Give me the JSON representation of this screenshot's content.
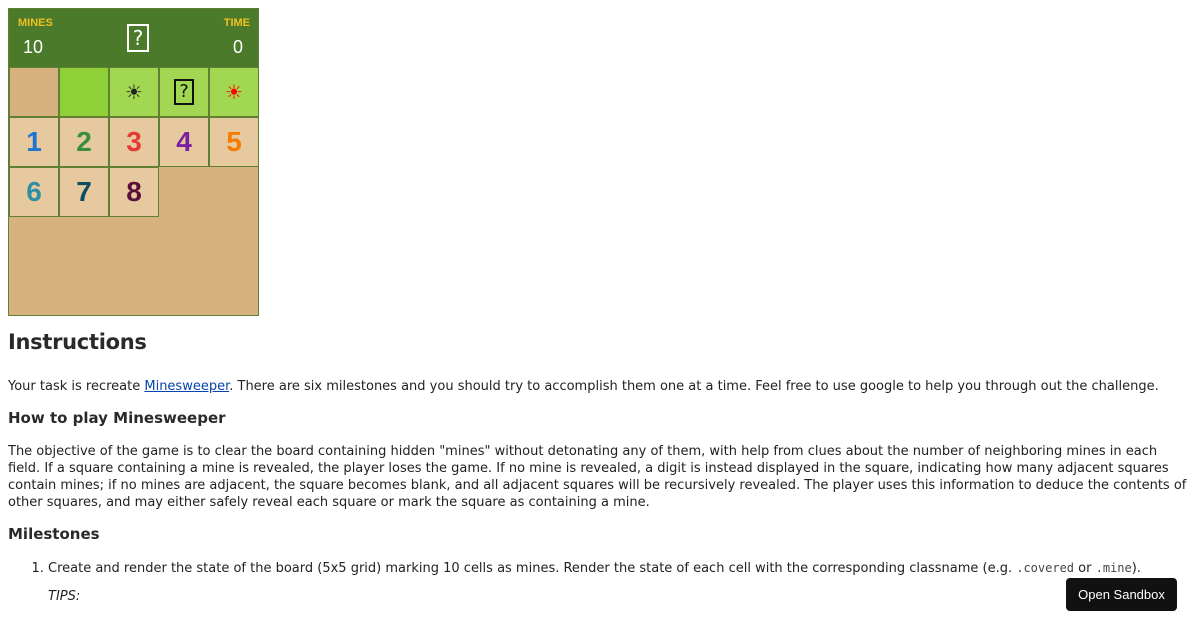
{
  "board": {
    "mines_label": "MINES",
    "mines_value": "10",
    "time_label": "TIME",
    "time_value": "0",
    "face_glyph": "?",
    "row1": [
      {
        "type": "blank",
        "text": ""
      },
      {
        "type": "covered",
        "text": ""
      },
      {
        "type": "mine",
        "text": "☀",
        "color": "#111111"
      },
      {
        "type": "unknown",
        "text": "?"
      },
      {
        "type": "mine-exploded",
        "text": "☀",
        "color": "#ff0000"
      }
    ],
    "numbers": [
      {
        "text": "1",
        "color": "#1e74d1"
      },
      {
        "text": "2",
        "color": "#388e3c"
      },
      {
        "text": "3",
        "color": "#e53935"
      },
      {
        "text": "4",
        "color": "#7b1fa2"
      },
      {
        "text": "5",
        "color": "#f57c00"
      },
      {
        "text": "6",
        "color": "#2e8fa0"
      },
      {
        "text": "7",
        "color": "#0b4c5f"
      },
      {
        "text": "8",
        "color": "#5a0f3a"
      }
    ]
  },
  "content": {
    "title": "Instructions",
    "intro_before": "Your task is recreate ",
    "intro_link": "Minesweeper",
    "intro_after": ". There are six milestones and you should try to accomplish them one at a time. Feel free to use google to help you through out the challenge.",
    "how_heading": "How to play Minesweeper",
    "how_text": "The objective of the game is to clear the board containing hidden \"mines\" without detonating any of them, with help from clues about the number of neighboring mines in each field. If a square containing a mine is revealed, the player loses the game. If no mine is revealed, a digit is instead displayed in the square, indicating how many adjacent squares contain mines; if no mines are adjacent, the square becomes blank, and all adjacent squares will be recursively revealed. The player uses this information to deduce the contents of other squares, and may either safely reveal each square or mark the square as containing a mine.",
    "milestones_heading": "Milestones",
    "milestone1_before": "Create and render the state of the board (5x5 grid) marking 10 cells as mines. Render the state of each cell with the corresponding classname (e.g. ",
    "milestone1_code1": ".covered",
    "milestone1_or": " or ",
    "milestone1_code2": ".mine",
    "milestone1_after": ").",
    "tips": "TIPS:"
  },
  "sandbox_button": "Open Sandbox"
}
